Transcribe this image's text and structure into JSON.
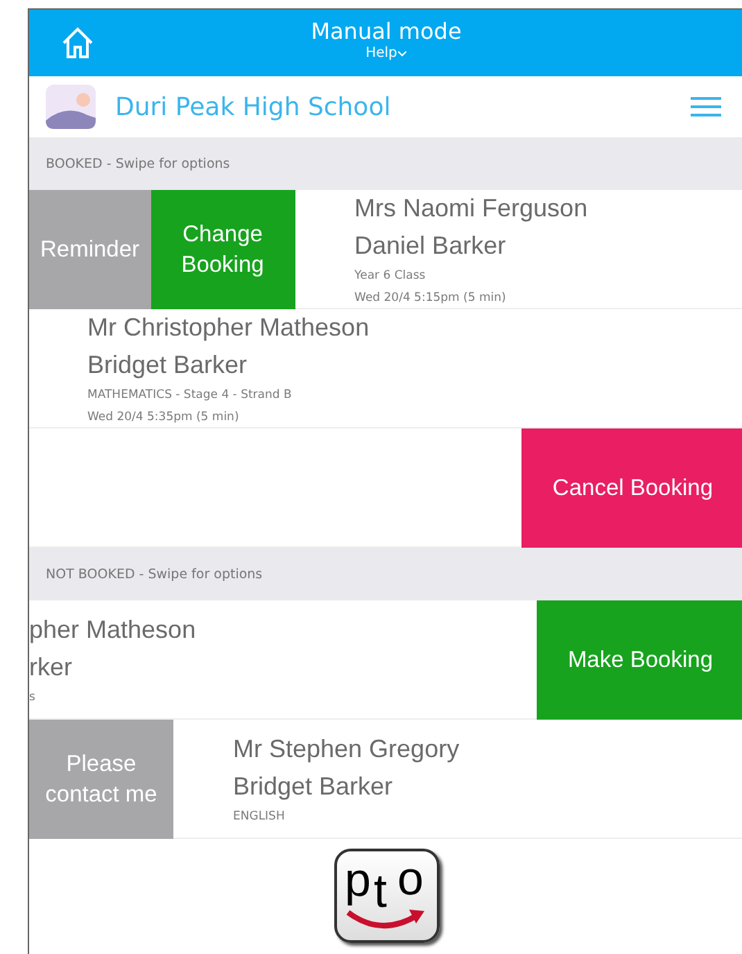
{
  "header": {
    "title": "Manual mode",
    "help": "Help"
  },
  "school": {
    "name": "Duri Peak High School"
  },
  "sections": [
    {
      "heading": "BOOKED - Swipe for options",
      "rows": [
        {
          "kind": "swiped_right",
          "actions": [
            {
              "label": "Reminder",
              "kind": "neutral"
            },
            {
              "label": "Change Booking",
              "kind": "confirm"
            }
          ],
          "teacher": "Mrs Naomi Ferguson",
          "student": "Daniel Barker",
          "subject": "Year 6 Class",
          "time": "Wed 20/4 5:15pm (5 min)"
        },
        {
          "kind": "plain",
          "teacher": "Mr Christopher Matheson",
          "student": "Bridget Barker",
          "subject": "MATHEMATICS - Stage 4 - Strand B",
          "time": "Wed 20/4 5:35pm (5 min)"
        },
        {
          "kind": "swiped_left",
          "actions": [
            {
              "label": "Cancel Booking",
              "kind": "danger"
            }
          ]
        }
      ]
    },
    {
      "heading": "NOT BOOKED - Swipe for options",
      "rows": [
        {
          "kind": "swiped_left",
          "teacher": "pher Matheson",
          "student": "rker",
          "subject": "s",
          "actions": [
            {
              "label": "Make Booking",
              "kind": "confirm"
            }
          ]
        },
        {
          "kind": "swiped_right",
          "actions": [
            {
              "label": "Please contact me",
              "kind": "neutral"
            }
          ],
          "teacher": "Mr Stephen Gregory",
          "student": "Bridget Barker",
          "subject": "ENGLISH"
        }
      ]
    }
  ],
  "footer": {
    "logo_letters": [
      "p",
      "t",
      "o"
    ]
  }
}
